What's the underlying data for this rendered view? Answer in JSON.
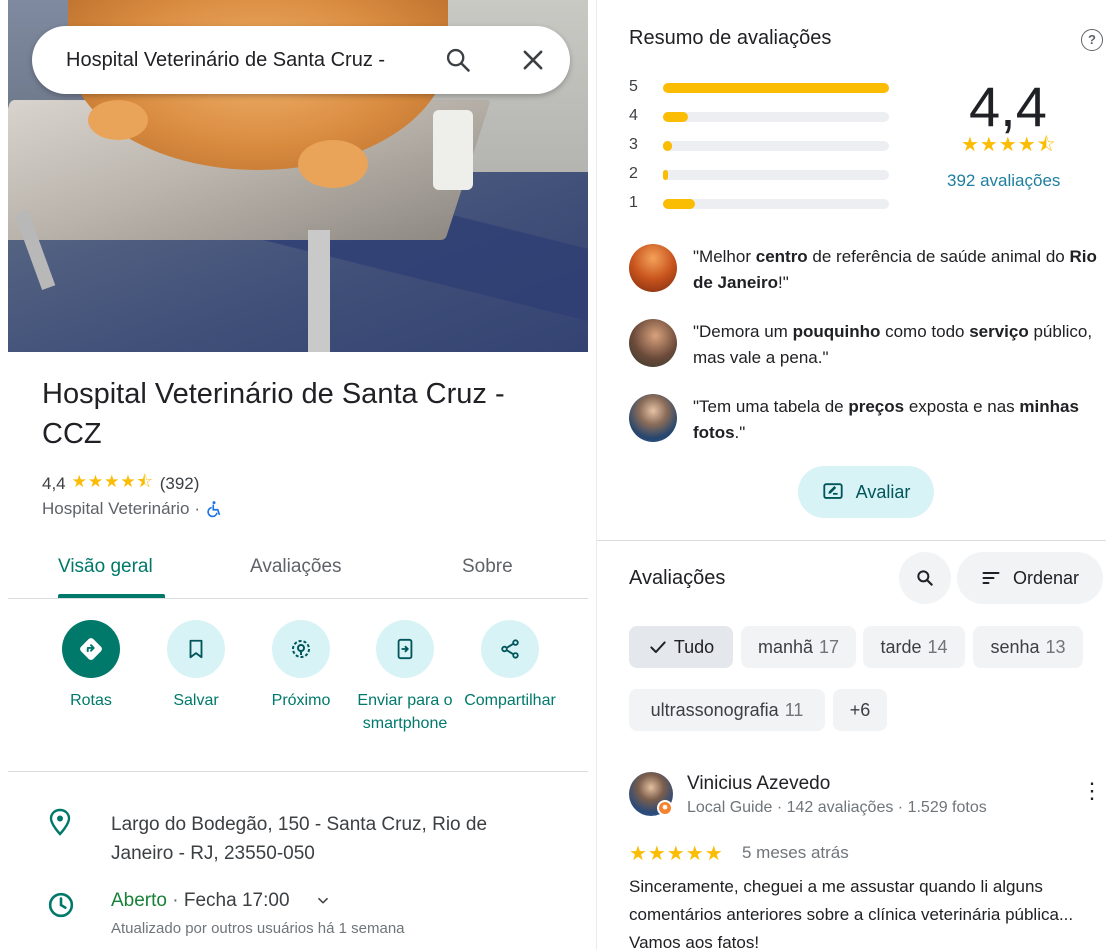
{
  "search": {
    "query": "Hospital Veterinário de Santa Cruz -"
  },
  "place": {
    "title": "Hospital Veterinário de Santa Cruz - CCZ",
    "rating": "4,4",
    "stars": "★★★★⯪",
    "review_count": "(392)",
    "category": "Hospital Veterinário",
    "separator": "·"
  },
  "tabs": [
    {
      "label": "Visão geral",
      "active": true
    },
    {
      "label": "Avaliações",
      "active": false
    },
    {
      "label": "Sobre",
      "active": false
    }
  ],
  "actions": [
    {
      "label": "Rotas",
      "icon": "directions-icon"
    },
    {
      "label": "Salvar",
      "icon": "bookmark-icon"
    },
    {
      "label": "Próximo",
      "icon": "nearby-icon"
    },
    {
      "label": "Enviar para o smartphone",
      "icon": "send-to-phone-icon"
    },
    {
      "label": "Compartilhar",
      "icon": "share-icon"
    }
  ],
  "info": {
    "address": "Largo do Bodegão, 150 - Santa Cruz, Rio de Janeiro - RJ, 23550-050",
    "open_status": "Aberto",
    "hours_sep": " · ",
    "closes": "Fecha 17:00",
    "updated": "Atualizado por outros usuários há 1 semana"
  },
  "summary": {
    "title": "Resumo de avaliações",
    "help": "?",
    "histogram": [
      {
        "star": "5",
        "fraction": 1.0
      },
      {
        "star": "4",
        "fraction": 0.11
      },
      {
        "star": "3",
        "fraction": 0.04
      },
      {
        "star": "2",
        "fraction": 0.02
      },
      {
        "star": "1",
        "fraction": 0.14
      }
    ],
    "rating": "4,4",
    "stars": "★★★★⯪",
    "count_link": "392 avaliações"
  },
  "snippets": [
    {
      "parts": [
        [
          "\"Melhor ",
          false
        ],
        [
          "centro",
          true
        ],
        [
          " de referência de saúde animal do ",
          false
        ],
        [
          "Rio de Janeiro",
          true
        ],
        [
          "!\"",
          false
        ]
      ]
    },
    {
      "parts": [
        [
          "\"Demora um ",
          false
        ],
        [
          "pouquinho",
          true
        ],
        [
          " como todo ",
          false
        ],
        [
          "serviço",
          true
        ],
        [
          " público, mas vale a pena.\"",
          false
        ]
      ]
    },
    {
      "parts": [
        [
          "\"Tem uma tabela de ",
          false
        ],
        [
          "preços",
          true
        ],
        [
          " exposta e nas ",
          false
        ],
        [
          "minhas fotos",
          true
        ],
        [
          ".\"",
          false
        ]
      ]
    }
  ],
  "rate_button": "Avaliar",
  "reviews": {
    "title": "Avaliações",
    "sort_label": "Ordenar",
    "chips": [
      {
        "label": "Tudo",
        "count": "",
        "selected": true
      },
      {
        "label": "manhã",
        "count": "17",
        "selected": false
      },
      {
        "label": "tarde",
        "count": "14",
        "selected": false
      },
      {
        "label": "senha",
        "count": "13",
        "selected": false
      },
      {
        "label": "ultrassonografia",
        "count": "11",
        "selected": false
      },
      {
        "label": "+6",
        "count": "",
        "selected": false
      }
    ],
    "first": {
      "author": "Vinicius Azevedo",
      "meta": "Local Guide · 142 avaliações · 1.529 fotos",
      "stars": "★★★★★",
      "when": "5 meses atrás",
      "text": "Sinceramente, cheguei a me assustar quando li alguns comentários anteriores sobre a clínica veterinária pública... Vamos aos fatos!"
    }
  },
  "colors": {
    "accent": "#00796b",
    "star": "#fbbc04",
    "chip_bg": "#f1f3f4",
    "action_bg": "#d8f3f6"
  }
}
